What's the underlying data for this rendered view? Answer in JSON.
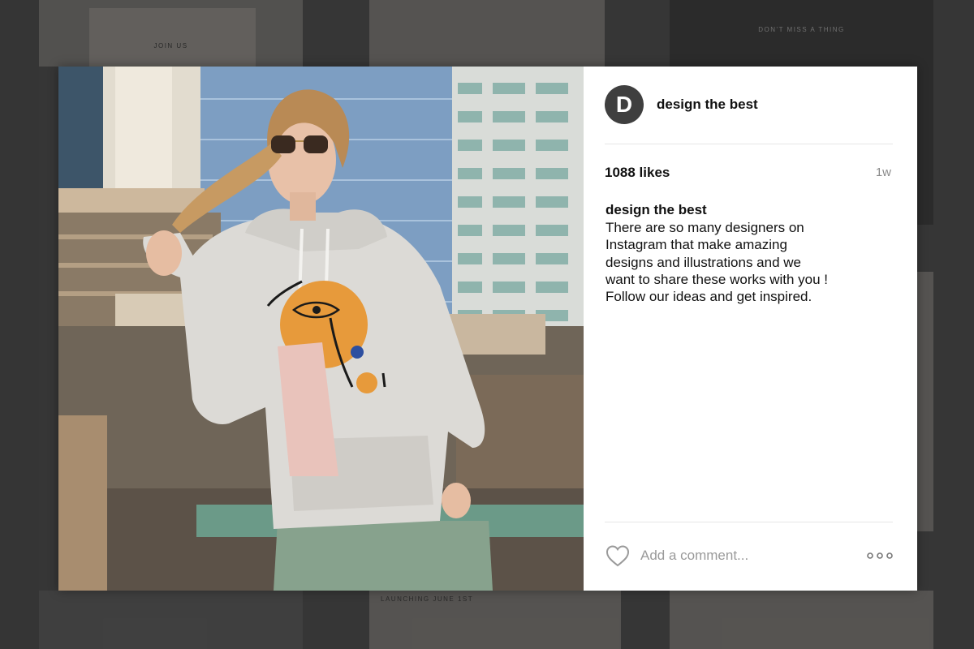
{
  "background": {
    "tiles": [
      {
        "text": "JOIN US"
      },
      {
        "text": "DON'T MISS A THING"
      },
      {
        "text": "LAUNCHING JUNE 1ST"
      }
    ]
  },
  "post": {
    "avatar_letter": "D",
    "username": "design the best",
    "likes": "1088 likes",
    "time": "1w",
    "caption_user": "design the best",
    "caption_text": "There are so many designers on Instagram that make amazing designs and illustrations and we want to share these works with you ! Follow our ideas and get inspired.",
    "comment_placeholder": "Add a comment...",
    "icons": {
      "like": "heart-icon",
      "more": "more-options-icon"
    }
  },
  "colors": {
    "avatar_bg": "#3f3f3f",
    "hoodie": "#dcdad6",
    "accent_orange": "#e79a3b",
    "accent_blue": "#2d4fa0",
    "accent_pink": "#e9c3bb"
  }
}
